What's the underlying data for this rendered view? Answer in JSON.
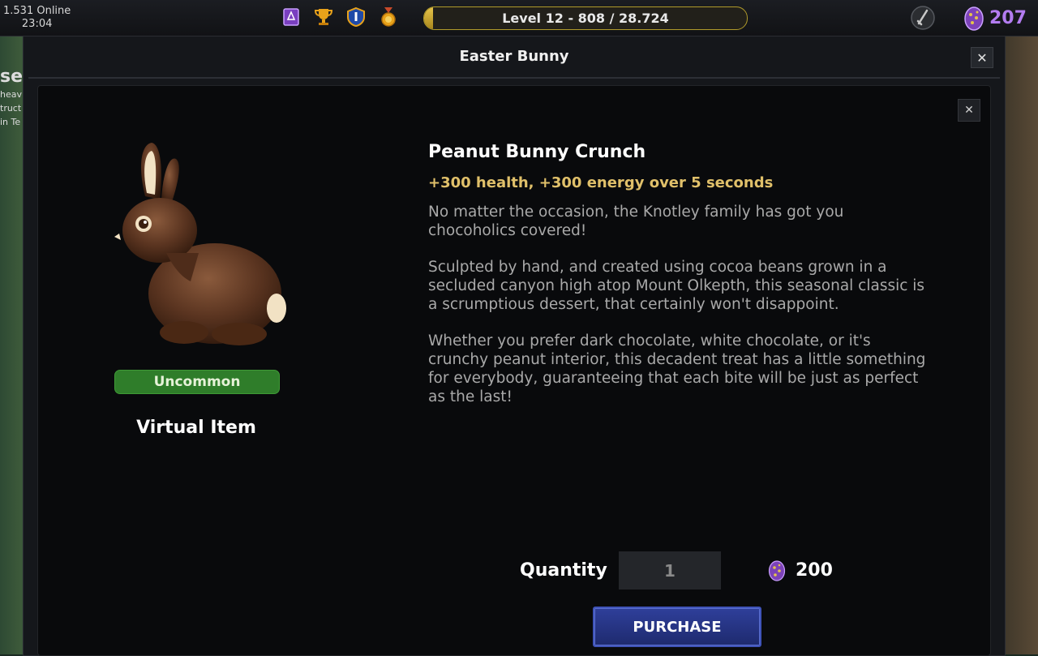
{
  "hud": {
    "online": "1.531 Online",
    "time": "23:04",
    "level_text": "Level  12  -  808 / 28.724",
    "level_progress": 0.028,
    "currency": "207"
  },
  "window": {
    "title": "Easter Bunny",
    "close": "✕"
  },
  "background": {
    "left_fragments": [
      "se",
      "heav",
      "truct",
      "",
      "in Te"
    ]
  },
  "item": {
    "close": "✕",
    "rarity": "Uncommon",
    "type": "Virtual Item",
    "name": "Peanut Bunny Crunch",
    "effect": "+300 health, +300 energy over 5 seconds",
    "description": [
      "No matter the occasion, the Knotley family has got you chocoholics covered!",
      "Sculpted by hand, and created using cocoa beans grown in a secluded canyon high atop Mount Olkepth, this seasonal classic is a scrumptious dessert, that certainly won't disappoint.",
      "Whether you prefer dark chocolate, white chocolate, or it's crunchy peanut interior, this decadent treat has a little something for everybody, guaranteeing that each bite will be just as perfect as the last!"
    ]
  },
  "purchase": {
    "quantity_label": "Quantity",
    "quantity_value": "1",
    "price": "200",
    "button_label": "PURCHASE"
  },
  "colors": {
    "rarity_green": "#2f7d2a",
    "effect_gold": "#e0c06a",
    "currency_purple": "#b37cf0",
    "purchase_blue": "#2f3f9a"
  }
}
